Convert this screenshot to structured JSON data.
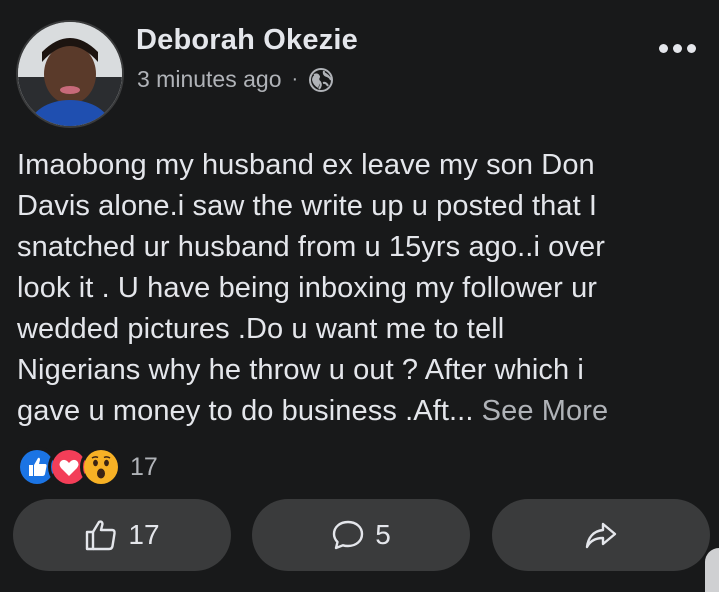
{
  "post": {
    "author": "Deborah Okezie",
    "timestamp": "3 minutes ago",
    "separator": "·",
    "audience_icon": "globe-icon",
    "more_icon": "more-options-icon",
    "text_lines": [
      "Imaobong my husband ex leave my son Don",
      "Davis alone.i saw the write up u posted that I",
      "snatched ur husband from u 15yrs ago..i over",
      "look it . U have being inboxing my follower ur",
      "wedded pictures .Do u want me to tell",
      "Nigerians why he throw u out ? After which i"
    ],
    "last_line": "gave u money to do business .Aft...",
    "see_more": "See More"
  },
  "reactions": {
    "types": [
      "like-reaction-icon",
      "love-reaction-icon",
      "wow-reaction-icon"
    ],
    "count": "17"
  },
  "actions": {
    "like_count": "17",
    "comment_count": "5",
    "like_icon": "thumbs-up-icon",
    "comment_icon": "comment-bubble-icon",
    "share_icon": "share-arrow-icon"
  },
  "colors": {
    "background": "#18191a",
    "button_bg": "#3a3b3c",
    "text_primary": "#e4e6eb",
    "text_secondary": "#b0b3b8",
    "like_blue": "#1b74e4",
    "love_red": "#f33e58",
    "wow_yellow": "#f7b125"
  }
}
